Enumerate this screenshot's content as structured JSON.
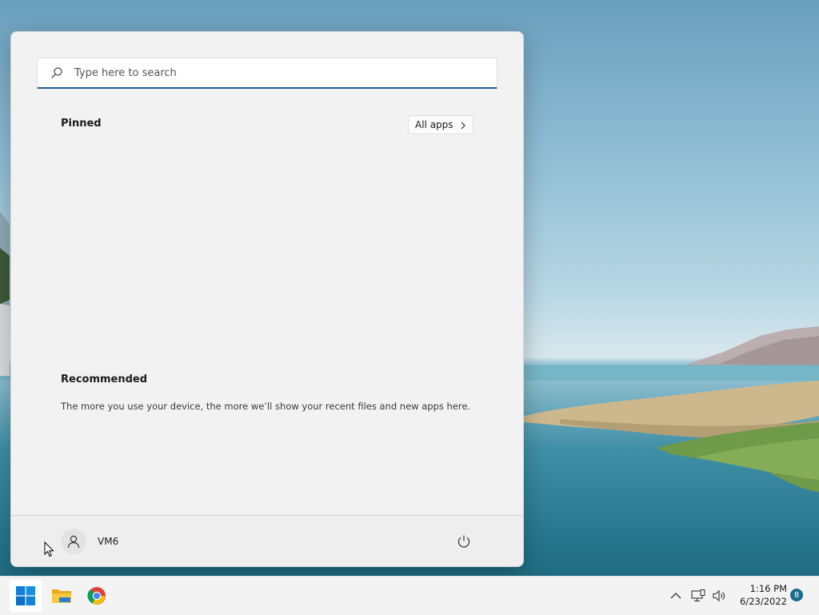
{
  "start_menu": {
    "search": {
      "placeholder": "Type here to search"
    },
    "pinned": {
      "title": "Pinned",
      "all_apps_label": "All apps"
    },
    "recommended": {
      "title": "Recommended",
      "empty_message": "The more you use your device, the more we’ll show your recent files and new apps here."
    },
    "footer": {
      "user_name": "VM6"
    }
  },
  "taskbar": {
    "apps": [
      "windows-start-icon",
      "file-explorer-icon",
      "chrome-icon"
    ],
    "tray": {
      "time": "1:16 PM",
      "date": "6/23/2022",
      "notification_count": "8"
    }
  },
  "colors": {
    "accent": "#1f5b8f",
    "menu_bg": "#f2f2f2",
    "taskbar_bg": "#f3f3f3",
    "badge": "#1d6b8c"
  }
}
